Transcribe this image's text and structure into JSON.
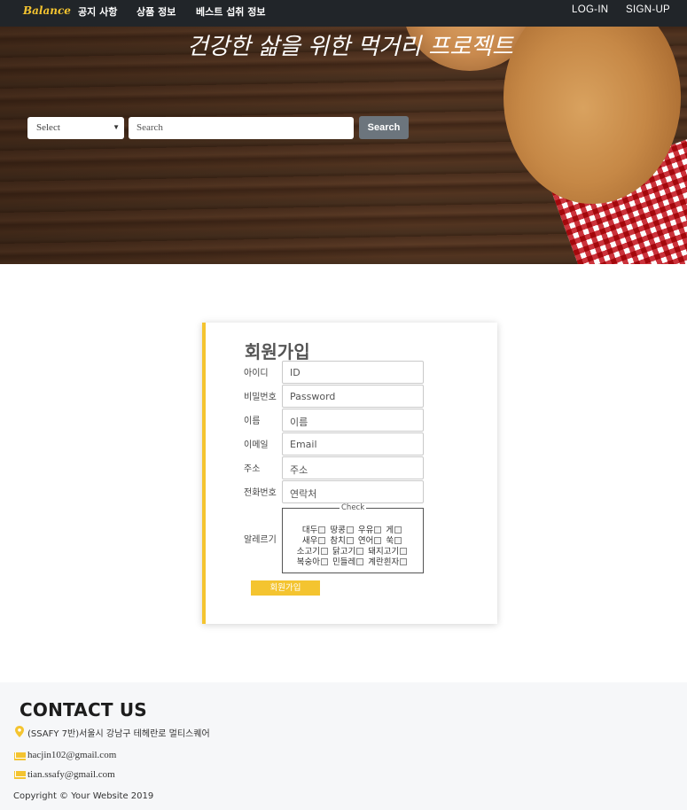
{
  "nav": {
    "brand": "Balance",
    "items": [
      "공지 사항",
      "상품 정보",
      "베스트 섭취 정보"
    ],
    "login": "LOG-IN",
    "signup": "SIGN-UP"
  },
  "hero": {
    "title": "건강한 삶을 위한 먹거리 프로젝트",
    "select_value": "Select",
    "search_placeholder": "Search",
    "search_button": "Search"
  },
  "signup": {
    "title": "회원가입",
    "fields": [
      {
        "label": "아이디",
        "placeholder": "ID"
      },
      {
        "label": "비밀번호",
        "placeholder": "Password"
      },
      {
        "label": "이름",
        "placeholder": "이름"
      },
      {
        "label": "이메일",
        "placeholder": "Email"
      },
      {
        "label": "주소",
        "placeholder": "주소"
      },
      {
        "label": "전화번호",
        "placeholder": "연락처"
      }
    ],
    "allergy_label": "알레르기",
    "check_legend": "Check",
    "allergies": [
      "대두",
      "땅콩",
      "우유",
      "게",
      "새우",
      "참치",
      "연어",
      "쑥",
      "소고기",
      "닭고기",
      "돼지고기",
      "복숭아",
      "민들레",
      "계란흰자"
    ],
    "submit": "회원가입"
  },
  "footer": {
    "title": "CONTACT US",
    "address": "(SSAFY 7반)서울시 강남구 테헤란로 멀티스퀘어",
    "emails": [
      "hacjin102@gmail.com",
      "tian.ssafy@gmail.com"
    ],
    "copyright": "Copyright © Your Website 2019"
  },
  "colors": {
    "accent": "#f4c430",
    "nav_bg": "#212529",
    "button_gray": "#6c757d"
  }
}
